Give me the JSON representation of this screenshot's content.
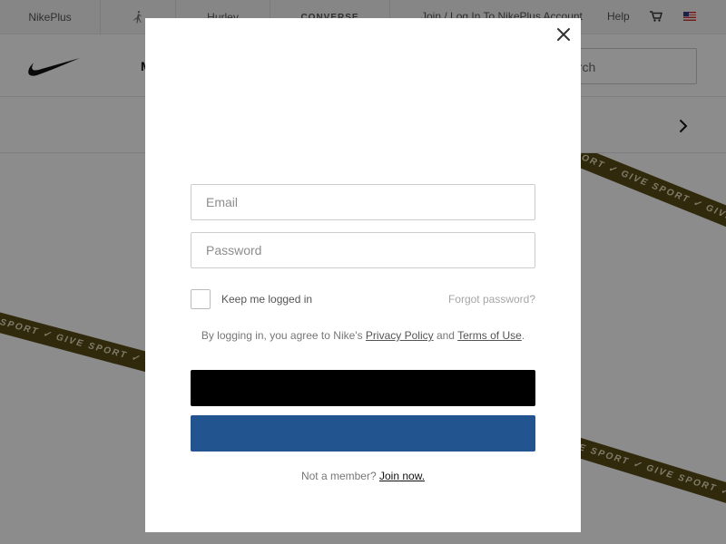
{
  "topbar": {
    "nikeplus_label": "NikePlus",
    "hurley_label": "Hurley",
    "converse_label": "CONVERSE",
    "account_link": "Join / Log In To NikePlus Account",
    "help_link": "Help"
  },
  "mainnav": {
    "first_item_fragment": "M",
    "search_fragment": "arch"
  },
  "hero": {
    "ribbon_text": "GIVE SPORT ✓ GIVE SPORT ✓ GIVE SPORT ✓ GIVE SPORT"
  },
  "login": {
    "email_placeholder": "Email",
    "password_placeholder": "Password",
    "keep_logged_in": "Keep me logged in",
    "forgot_password": "Forgot password?",
    "terms_prefix": "By logging in, you agree to Nike's",
    "privacy_link": "Privacy Policy",
    "terms_and": "and",
    "terms_link": "Terms of Use",
    "terms_suffix": ".",
    "signin_label": "",
    "facebook_label": "",
    "not_member": "Not a member?",
    "join_link": "Join now."
  },
  "colors": {
    "facebook_blue": "#22558f",
    "signin_black": "#000000",
    "ribbon_olive": "#5a4c16"
  }
}
